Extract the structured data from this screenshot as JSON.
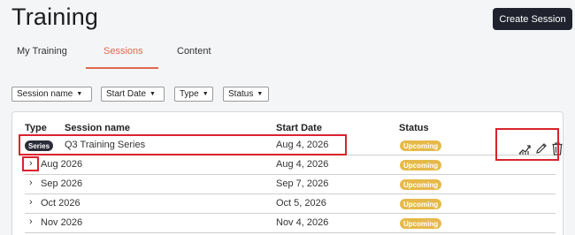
{
  "page": {
    "title": "Training"
  },
  "header": {
    "create_button": "Create Session"
  },
  "tabs": [
    {
      "label": "My Training",
      "active": false
    },
    {
      "label": "Sessions",
      "active": true
    },
    {
      "label": "Content",
      "active": false
    }
  ],
  "filters": [
    {
      "label": "Session name"
    },
    {
      "label": "Start Date"
    },
    {
      "label": "Type"
    },
    {
      "label": "Status"
    }
  ],
  "table": {
    "columns": [
      "Type",
      "Session name",
      "Start Date",
      "Status"
    ],
    "series_row": {
      "type_badge": "Series",
      "name": "Q3 Training Series",
      "start_date": "Aug 4, 2026",
      "status": "Upcoming"
    },
    "rows": [
      {
        "name": "Aug 2026",
        "start_date": "Aug 4, 2026",
        "status": "Upcoming"
      },
      {
        "name": "Sep 2026",
        "start_date": "Sep 7, 2026",
        "status": "Upcoming"
      },
      {
        "name": "Oct 2026",
        "start_date": "Oct 5, 2026",
        "status": "Upcoming"
      },
      {
        "name": "Nov 2026",
        "start_date": "Nov 4, 2026",
        "status": "Upcoming"
      }
    ]
  },
  "actions": [
    "analytics-icon",
    "pencil-icon",
    "trash-icon"
  ],
  "colors": {
    "accent": "#e2674c",
    "status_upcoming": "#e6b94a",
    "highlight": "#d9232e",
    "button_dark": "#20232e"
  }
}
